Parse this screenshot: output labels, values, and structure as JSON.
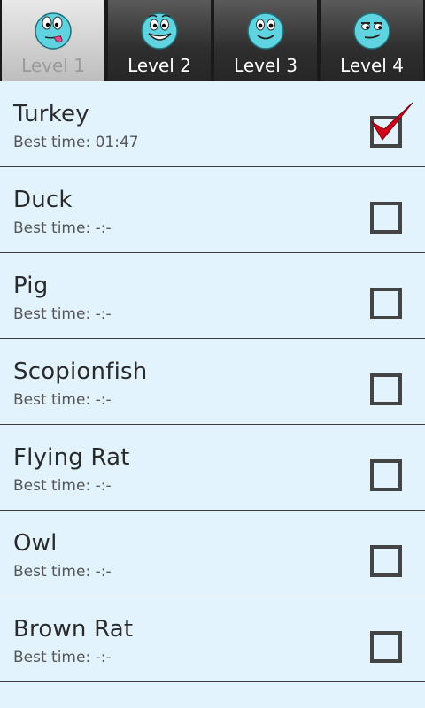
{
  "tabs": [
    {
      "label": "Level 1",
      "icon": "tongue-face-icon",
      "selected": true
    },
    {
      "label": "Level 2",
      "icon": "grin-face-icon",
      "selected": false
    },
    {
      "label": "Level 3",
      "icon": "smile-face-icon",
      "selected": false
    },
    {
      "label": "Level 4",
      "icon": "smirk-face-icon",
      "selected": false
    }
  ],
  "levels": [
    {
      "name": "Turkey",
      "best_time": "Best time: 01:47",
      "completed": true
    },
    {
      "name": "Duck",
      "best_time": "Best time: -:-",
      "completed": false
    },
    {
      "name": "Pig",
      "best_time": "Best time: -:-",
      "completed": false
    },
    {
      "name": "Scopionfish",
      "best_time": "Best time: -:-",
      "completed": false
    },
    {
      "name": "Flying Rat",
      "best_time": "Best time: -:-",
      "completed": false
    },
    {
      "name": "Owl",
      "best_time": "Best time: -:-",
      "completed": false
    },
    {
      "name": "Brown Rat",
      "best_time": "Best time: -:-",
      "completed": false
    }
  ],
  "colors": {
    "background": "#e2f3fe",
    "check": "#d0021b",
    "face": "#5fd3df"
  }
}
